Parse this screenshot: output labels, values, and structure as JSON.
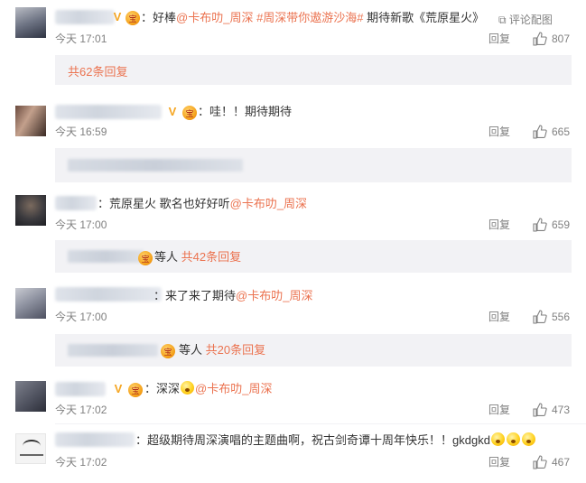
{
  "comments": [
    {
      "text_plain": "：好棒",
      "mention": "@卡布叻_周深",
      "hashtags": "#周深带你遨游沙海#",
      "text_tail": "期待新歌《荒原星火》",
      "time": "今天 17:01",
      "reply": "回复",
      "likes": "807",
      "thread_link": "共62条回复",
      "comment_pic": "评论配图"
    },
    {
      "text_plain": "：哇！！期待期待",
      "time": "今天 16:59",
      "reply": "回复",
      "likes": "665"
    },
    {
      "text_plain": "：荒原星火 歌名也好好听",
      "mention": "@卡布叻_周深",
      "time": "今天 17:00",
      "reply": "回复",
      "likes": "659",
      "sub_suffix": "等人",
      "thread_link": "共42条回复"
    },
    {
      "text_plain": "：来了来了期待",
      "mention": "@卡布叻_周深",
      "time": "今天 17:00",
      "reply": "回复",
      "likes": "556",
      "sub_suffix": "等人",
      "thread_link": "共20条回复"
    },
    {
      "text_plain": "：深深",
      "mention": "@卡布叻_周深",
      "time": "今天 17:02",
      "reply": "回复",
      "likes": "473"
    },
    {
      "text_plain": "：超级期待周深演唱的主题曲啊，祝古剑奇谭十周年快乐！！gkdgkd",
      "time": "今天 17:02",
      "reply": "回复",
      "likes": "467"
    }
  ],
  "icons": {
    "vip": "V",
    "badge": "宝",
    "image_icon": "image-icon",
    "like_icon": "thumbs-up-icon"
  },
  "colors": {
    "link": "#eb7350",
    "meta": "#808080",
    "subbox": "#f2f2f5"
  }
}
